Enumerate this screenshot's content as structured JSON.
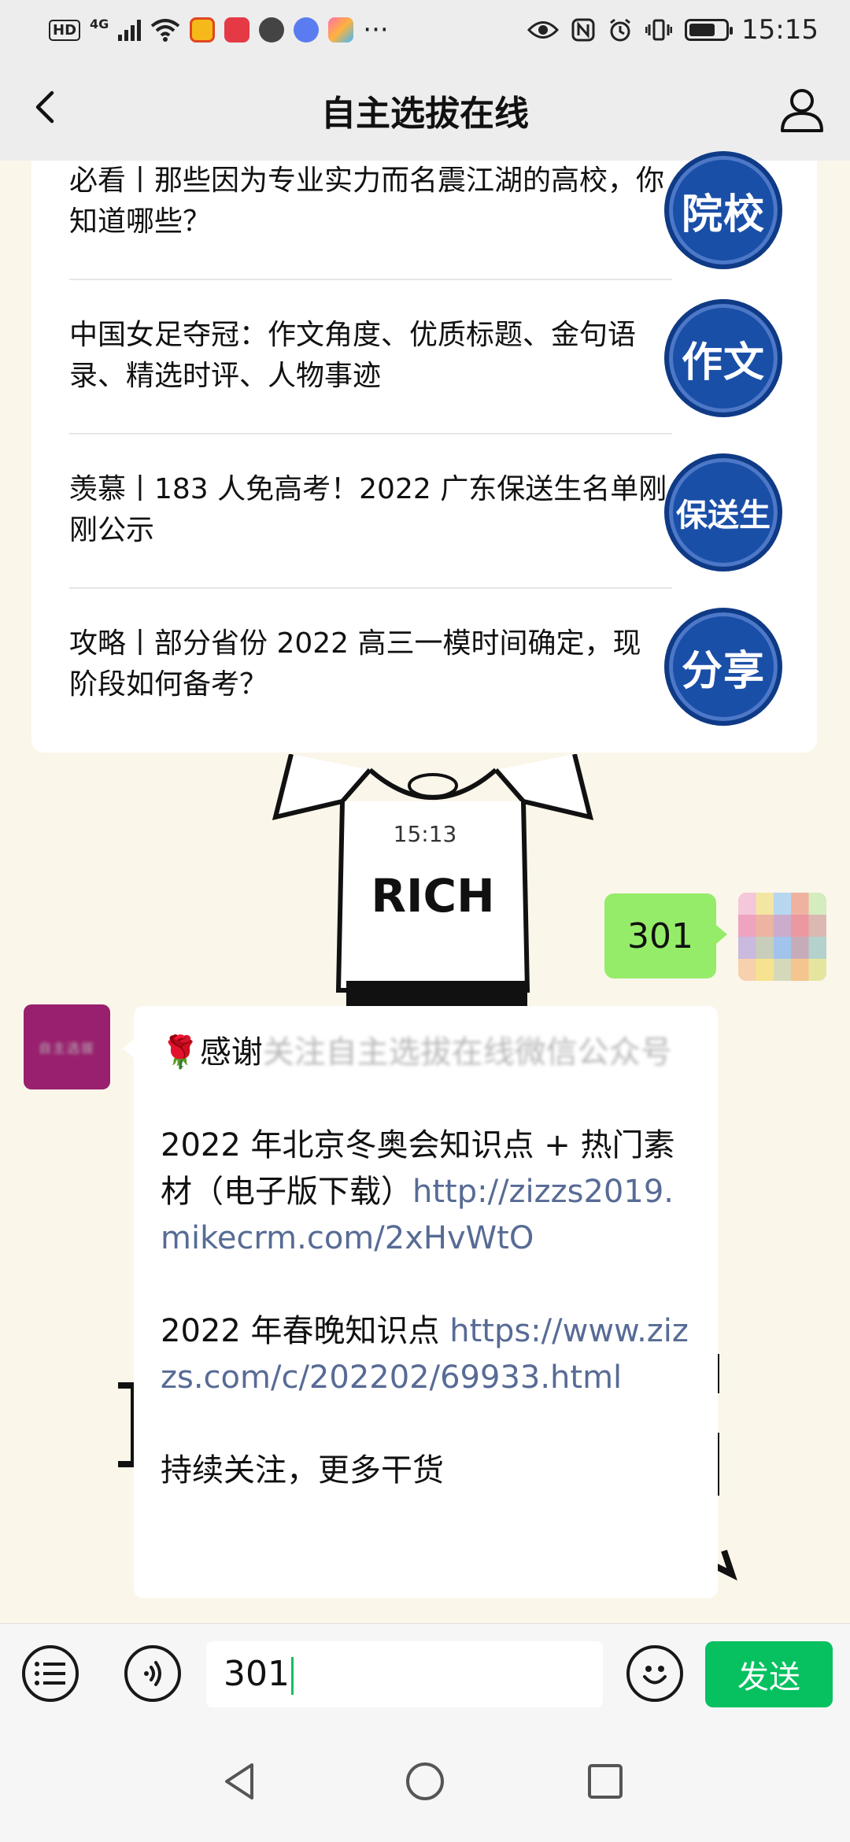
{
  "status_bar": {
    "hd": "HD",
    "network": "4G",
    "time": "15:15",
    "dots": "···"
  },
  "nav": {
    "title": "自主选拔在线"
  },
  "articles": [
    {
      "text": "必看丨那些因为专业实力而名震江湖的高校，你知道哪些？",
      "badge": "院校"
    },
    {
      "text": "中国女足夺冠：作文角度、优质标题、金句语录、精选时评、人物事迹",
      "badge": "作文"
    },
    {
      "text": "羡慕丨183 人免高考！2022 广东保送生名单刚刚公示",
      "badge": "保送生"
    },
    {
      "text": "攻略丨部分省份 2022 高三一模时间确定，现阶段如何备考？",
      "badge": "分享"
    }
  ],
  "chat": {
    "timestamp": "15:13",
    "outgoing_message": "301",
    "background_shirt_text": "RICH",
    "official_avatar_text": "自主选拔",
    "reply": {
      "rose": "🌹",
      "thanks_visible": "感谢",
      "thanks_blurred": "关注自主选拔在线微信公众号",
      "line1": "2022 年北京冬奥会知识点 + 热门素材（电子版下载）",
      "link1": "http://zizzs2019.mikecrm.com/2xHvWtO",
      "line2": "2022 年春晚知识点 ",
      "link2": "https://www.zizzs.com/c/202202/69933.html",
      "line3": "持续关注，更多干货"
    }
  },
  "input_bar": {
    "text": "301",
    "send_label": "发送"
  },
  "colors": {
    "send_green": "#07c160",
    "outgoing_bubble": "#95ec69",
    "link": "#576b95",
    "badge_blue": "#1a4fa8"
  }
}
